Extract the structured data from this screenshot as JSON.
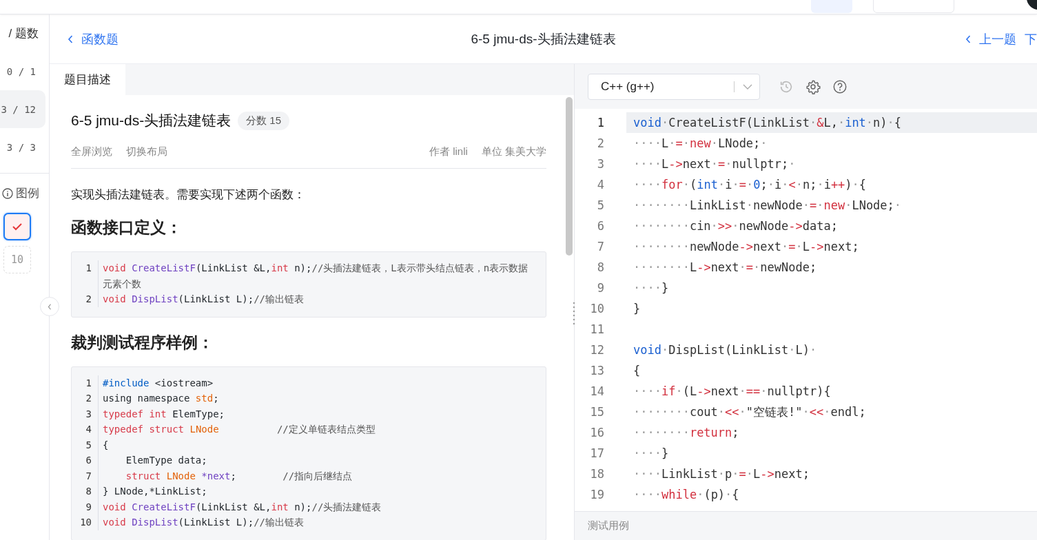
{
  "sidebar": {
    "header": "/ 题数",
    "groups": [
      {
        "count": "0 / 1",
        "selected": false
      },
      {
        "count": "3 / 12",
        "selected": true
      },
      {
        "count": "3 / 3",
        "selected": false
      }
    ],
    "legend_label": "图例",
    "legend": [
      {
        "kind": "correct",
        "selected": true
      },
      {
        "kind": "unanswered",
        "label": "10",
        "selected": false
      }
    ]
  },
  "header": {
    "back_link": "函数题",
    "title": "6-5 jmu-ds-头插法建链表",
    "prev_link": "上一题",
    "next_link": "下"
  },
  "problem": {
    "tabs": [
      {
        "label": "题目描述",
        "selected": true
      }
    ],
    "title": "6-5 jmu-ds-头插法建链表",
    "score": "分数 15",
    "actions": [
      "全屏浏览",
      "切换布局"
    ],
    "author_label": "作者",
    "author": "linli",
    "unit_label": "单位",
    "unit": "集美大学",
    "intro": "实现头插法建链表。需要实现下述两个函数：",
    "sections": [
      {
        "heading": "函数接口定义：",
        "code": [
          {
            "number": "1",
            "tokens": [
              {
                "text": "void",
                "color": "#d73a49"
              },
              {
                "text": " CreateListF",
                "color": "#6f42c1"
              },
              {
                "text": "(LinkList &L,",
                "color": "#24292e"
              },
              {
                "text": "int",
                "color": "#d73a49"
              },
              {
                "text": " n);",
                "color": "#24292e"
              },
              {
                "text": "//头插法建链表，L表示带头结点链表，n表示数据元素个数",
                "color": "#555555"
              }
            ]
          },
          {
            "number": "2",
            "tokens": [
              {
                "text": "void",
                "color": "#d73a49"
              },
              {
                "text": " DispList",
                "color": "#6f42c1"
              },
              {
                "text": "(LinkList L);",
                "color": "#24292e"
              },
              {
                "text": "//输出链表",
                "color": "#555555"
              }
            ]
          }
        ]
      },
      {
        "heading": "裁判测试程序样例：",
        "code": [
          {
            "number": "1",
            "tokens": [
              {
                "text": "#include",
                "color": "#005cc5"
              },
              {
                "text": " <iostream>",
                "color": "#24292e"
              }
            ]
          },
          {
            "number": "2",
            "tokens": [
              {
                "text": "using namespace",
                "color": "#24292e"
              },
              {
                "text": " std",
                "color": "#e36209"
              },
              {
                "text": ";",
                "color": "#24292e"
              }
            ]
          },
          {
            "number": "3",
            "tokens": [
              {
                "text": "typedef",
                "color": "#d73a49"
              },
              {
                "text": " int",
                "color": "#d73a49"
              },
              {
                "text": " ElemType;",
                "color": "#24292e"
              }
            ]
          },
          {
            "number": "4",
            "tokens": [
              {
                "text": "typedef",
                "color": "#d73a49"
              },
              {
                "text": " struct",
                "color": "#d73a49"
              },
              {
                "text": " LNode          ",
                "color": "#e36209"
              },
              {
                "text": "//定义单链表结点类型",
                "color": "#555555"
              }
            ]
          },
          {
            "number": "5",
            "tokens": [
              {
                "text": "{",
                "color": "#24292e"
              }
            ]
          },
          {
            "number": "6",
            "tokens": [
              {
                "text": "    ElemType data;",
                "color": "#24292e"
              }
            ]
          },
          {
            "number": "7",
            "tokens": [
              {
                "text": "    struct",
                "color": "#d73a49"
              },
              {
                "text": " LNode",
                "color": "#e36209"
              },
              {
                "text": " *next",
                "color": "#6f42c1"
              },
              {
                "text": ";        ",
                "color": "#24292e"
              },
              {
                "text": "//指向后继结点",
                "color": "#555555"
              }
            ]
          },
          {
            "number": "8",
            "tokens": [
              {
                "text": "} LNode,*LinkList;",
                "color": "#24292e"
              }
            ]
          },
          {
            "number": "9",
            "tokens": [
              {
                "text": "void",
                "color": "#d73a49"
              },
              {
                "text": " CreateListF",
                "color": "#6f42c1"
              },
              {
                "text": "(LinkList &L,",
                "color": "#24292e"
              },
              {
                "text": "int",
                "color": "#d73a49"
              },
              {
                "text": " n);",
                "color": "#24292e"
              },
              {
                "text": "//头插法建链表",
                "color": "#555555"
              }
            ]
          },
          {
            "number": "10",
            "tokens": [
              {
                "text": "void",
                "color": "#d73a49"
              },
              {
                "text": " DispList",
                "color": "#6f42c1"
              },
              {
                "text": "(LinkList L);",
                "color": "#24292e"
              },
              {
                "text": "//输出链表",
                "color": "#555555"
              }
            ]
          }
        ]
      }
    ]
  },
  "editor": {
    "language": "C++ (g++)",
    "lines": [
      {
        "number": "1",
        "current": true,
        "tokens": [
          {
            "text": "void",
            "color": "#1a5fd0"
          },
          {
            "text": "·CreateListF(LinkList·",
            "color": "#333333"
          },
          {
            "text": "&",
            "color": "#d2303e"
          },
          {
            "text": "L,·",
            "color": "#333333"
          },
          {
            "text": "int",
            "color": "#1a5fd0"
          },
          {
            "text": "·n)·{",
            "color": "#333333"
          }
        ]
      },
      {
        "number": "2",
        "current": false,
        "tokens": [
          {
            "text": "····L·",
            "color": "#333333"
          },
          {
            "text": "=·new",
            "color": "#d2303e"
          },
          {
            "text": "·LNode;·",
            "color": "#333333"
          }
        ]
      },
      {
        "number": "3",
        "current": false,
        "tokens": [
          {
            "text": "····L",
            "color": "#333333"
          },
          {
            "text": "->",
            "color": "#d2303e"
          },
          {
            "text": "next·",
            "color": "#333333"
          },
          {
            "text": "=",
            "color": "#d2303e"
          },
          {
            "text": "·nullptr;·",
            "color": "#333333"
          }
        ]
      },
      {
        "number": "4",
        "current": false,
        "tokens": [
          {
            "text": "····for",
            "color": "#d2303e"
          },
          {
            "text": "·(",
            "color": "#333333"
          },
          {
            "text": "int",
            "color": "#1a5fd0"
          },
          {
            "text": "·i·",
            "color": "#333333"
          },
          {
            "text": "=",
            "color": "#d2303e"
          },
          {
            "text": "·0",
            "color": "#1a5fd0"
          },
          {
            "text": ";·i·",
            "color": "#333333"
          },
          {
            "text": "<",
            "color": "#d2303e"
          },
          {
            "text": "·n;·i",
            "color": "#333333"
          },
          {
            "text": "++",
            "color": "#d2303e"
          },
          {
            "text": ")·{",
            "color": "#333333"
          }
        ]
      },
      {
        "number": "5",
        "current": false,
        "tokens": [
          {
            "text": "········LinkList·newNode·",
            "color": "#333333"
          },
          {
            "text": "=·new",
            "color": "#d2303e"
          },
          {
            "text": "·LNode;·",
            "color": "#333333"
          }
        ]
      },
      {
        "number": "6",
        "current": false,
        "tokens": [
          {
            "text": "········cin·",
            "color": "#333333"
          },
          {
            "text": ">>",
            "color": "#d2303e"
          },
          {
            "text": "·newNode",
            "color": "#333333"
          },
          {
            "text": "->",
            "color": "#d2303e"
          },
          {
            "text": "data;",
            "color": "#333333"
          }
        ]
      },
      {
        "number": "7",
        "current": false,
        "tokens": [
          {
            "text": "········newNode",
            "color": "#333333"
          },
          {
            "text": "->",
            "color": "#d2303e"
          },
          {
            "text": "next·",
            "color": "#333333"
          },
          {
            "text": "=",
            "color": "#d2303e"
          },
          {
            "text": "·L",
            "color": "#333333"
          },
          {
            "text": "->",
            "color": "#d2303e"
          },
          {
            "text": "next;",
            "color": "#333333"
          }
        ]
      },
      {
        "number": "8",
        "current": false,
        "tokens": [
          {
            "text": "········L",
            "color": "#333333"
          },
          {
            "text": "->",
            "color": "#d2303e"
          },
          {
            "text": "next·",
            "color": "#333333"
          },
          {
            "text": "=",
            "color": "#d2303e"
          },
          {
            "text": "·newNode;",
            "color": "#333333"
          }
        ]
      },
      {
        "number": "9",
        "current": false,
        "tokens": [
          {
            "text": "····}",
            "color": "#333333"
          }
        ]
      },
      {
        "number": "10",
        "current": false,
        "tokens": [
          {
            "text": "}",
            "color": "#333333"
          }
        ]
      },
      {
        "number": "11",
        "current": false
      },
      {
        "number": "12",
        "current": false,
        "tokens": [
          {
            "text": "void",
            "color": "#1a5fd0"
          },
          {
            "text": "·DispList(LinkList·L)·",
            "color": "#333333"
          }
        ]
      },
      {
        "number": "13",
        "current": false,
        "tokens": [
          {
            "text": "{",
            "color": "#333333"
          }
        ]
      },
      {
        "number": "14",
        "current": false,
        "tokens": [
          {
            "text": "····if",
            "color": "#d2303e"
          },
          {
            "text": "·(L",
            "color": "#333333"
          },
          {
            "text": "->",
            "color": "#d2303e"
          },
          {
            "text": "next·",
            "color": "#333333"
          },
          {
            "text": "==",
            "color": "#d2303e"
          },
          {
            "text": "·nullptr){",
            "color": "#333333"
          }
        ]
      },
      {
        "number": "15",
        "current": false,
        "tokens": [
          {
            "text": "········cout·",
            "color": "#333333"
          },
          {
            "text": "<<",
            "color": "#d2303e"
          },
          {
            "text": "·\"空链表!\"·",
            "color": "#333333"
          },
          {
            "text": "<<",
            "color": "#d2303e"
          },
          {
            "text": "·endl;",
            "color": "#333333"
          }
        ]
      },
      {
        "number": "16",
        "current": false,
        "tokens": [
          {
            "text": "········return",
            "color": "#d2303e"
          },
          {
            "text": ";",
            "color": "#333333"
          }
        ]
      },
      {
        "number": "17",
        "current": false,
        "tokens": [
          {
            "text": "····}",
            "color": "#333333"
          }
        ]
      },
      {
        "number": "18",
        "current": false,
        "tokens": [
          {
            "text": "····LinkList·p·",
            "color": "#333333"
          },
          {
            "text": "=",
            "color": "#d2303e"
          },
          {
            "text": "·L",
            "color": "#333333"
          },
          {
            "text": "->",
            "color": "#d2303e"
          },
          {
            "text": "next;",
            "color": "#333333"
          }
        ]
      },
      {
        "number": "19",
        "current": false,
        "tokens": [
          {
            "text": "····while",
            "color": "#d2303e"
          },
          {
            "text": "·(p)·{",
            "color": "#333333"
          }
        ]
      }
    ],
    "bottom_panel": "测试用例"
  }
}
